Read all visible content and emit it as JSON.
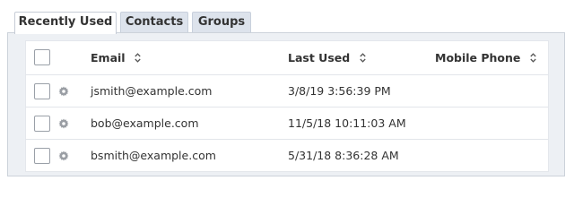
{
  "tabs": [
    {
      "label": "Recently Used",
      "active": true
    },
    {
      "label": "Contacts",
      "active": false
    },
    {
      "label": "Groups",
      "active": false
    }
  ],
  "table": {
    "columns": {
      "email": "Email",
      "last_used": "Last Used",
      "mobile_phone": "Mobile Phone"
    },
    "rows": [
      {
        "email": "jsmith@example.com",
        "last_used": "3/8/19 3:56:39 PM",
        "mobile_phone": ""
      },
      {
        "email": "bob@example.com",
        "last_used": "11/5/18 10:11:03 AM",
        "mobile_phone": ""
      },
      {
        "email": "bsmith@example.com",
        "last_used": "5/31/18 8:36:28 AM",
        "mobile_phone": ""
      }
    ]
  },
  "icons": {
    "row_action": "gear-icon",
    "sort": "sort-icon"
  },
  "colors": {
    "panel_bg": "#edf0f4",
    "inactive_tab_bg": "#dde3ec",
    "border": "#ccd2da",
    "text": "#333333"
  }
}
